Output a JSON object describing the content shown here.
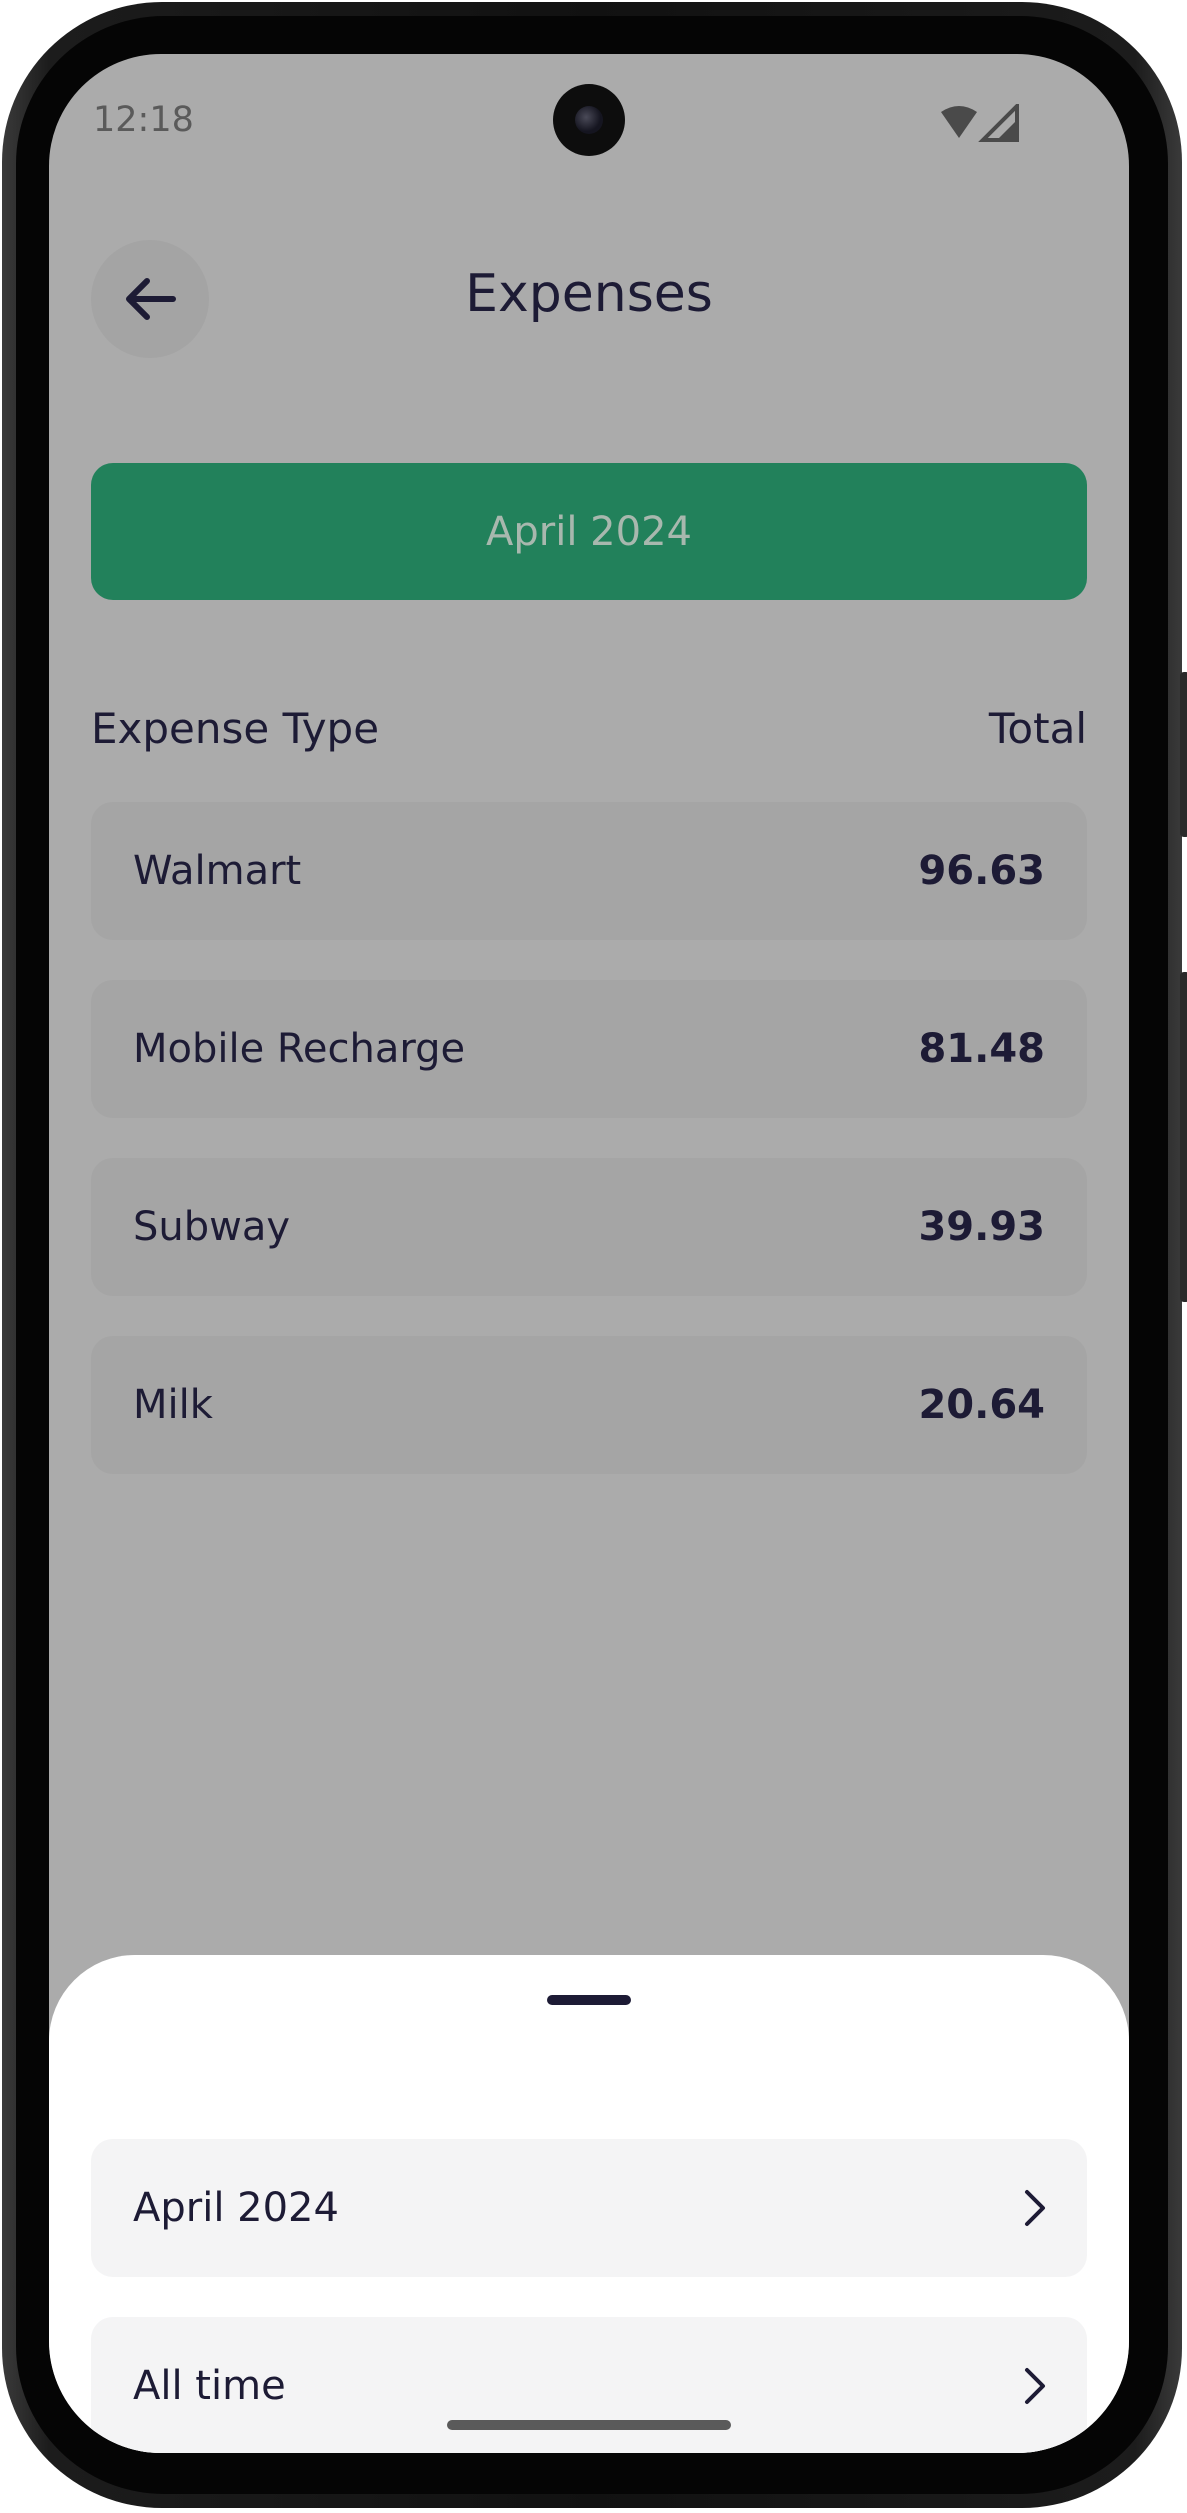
{
  "status_bar": {
    "time": "12:18",
    "wifi_icon": "wifi-icon",
    "signal_icon": "signal-icon"
  },
  "header": {
    "back_icon": "arrow-left-icon",
    "title": "Expenses"
  },
  "period_button": {
    "label": "April 2024"
  },
  "table": {
    "columns": {
      "left": "Expense Type",
      "right": "Total"
    },
    "rows": [
      {
        "name": "Walmart",
        "total": "96.63"
      },
      {
        "name": "Mobile Recharge",
        "total": "81.48"
      },
      {
        "name": "Subway",
        "total": "39.93"
      },
      {
        "name": "Milk",
        "total": "20.64"
      }
    ]
  },
  "sheet": {
    "options": [
      {
        "label": "April 2024",
        "icon": "chevron-right-icon"
      },
      {
        "label": "All time",
        "icon": "chevron-right-icon"
      }
    ]
  },
  "colors": {
    "accent": "#22815b",
    "text": "#1d1b35",
    "scrim": "#ababab"
  }
}
